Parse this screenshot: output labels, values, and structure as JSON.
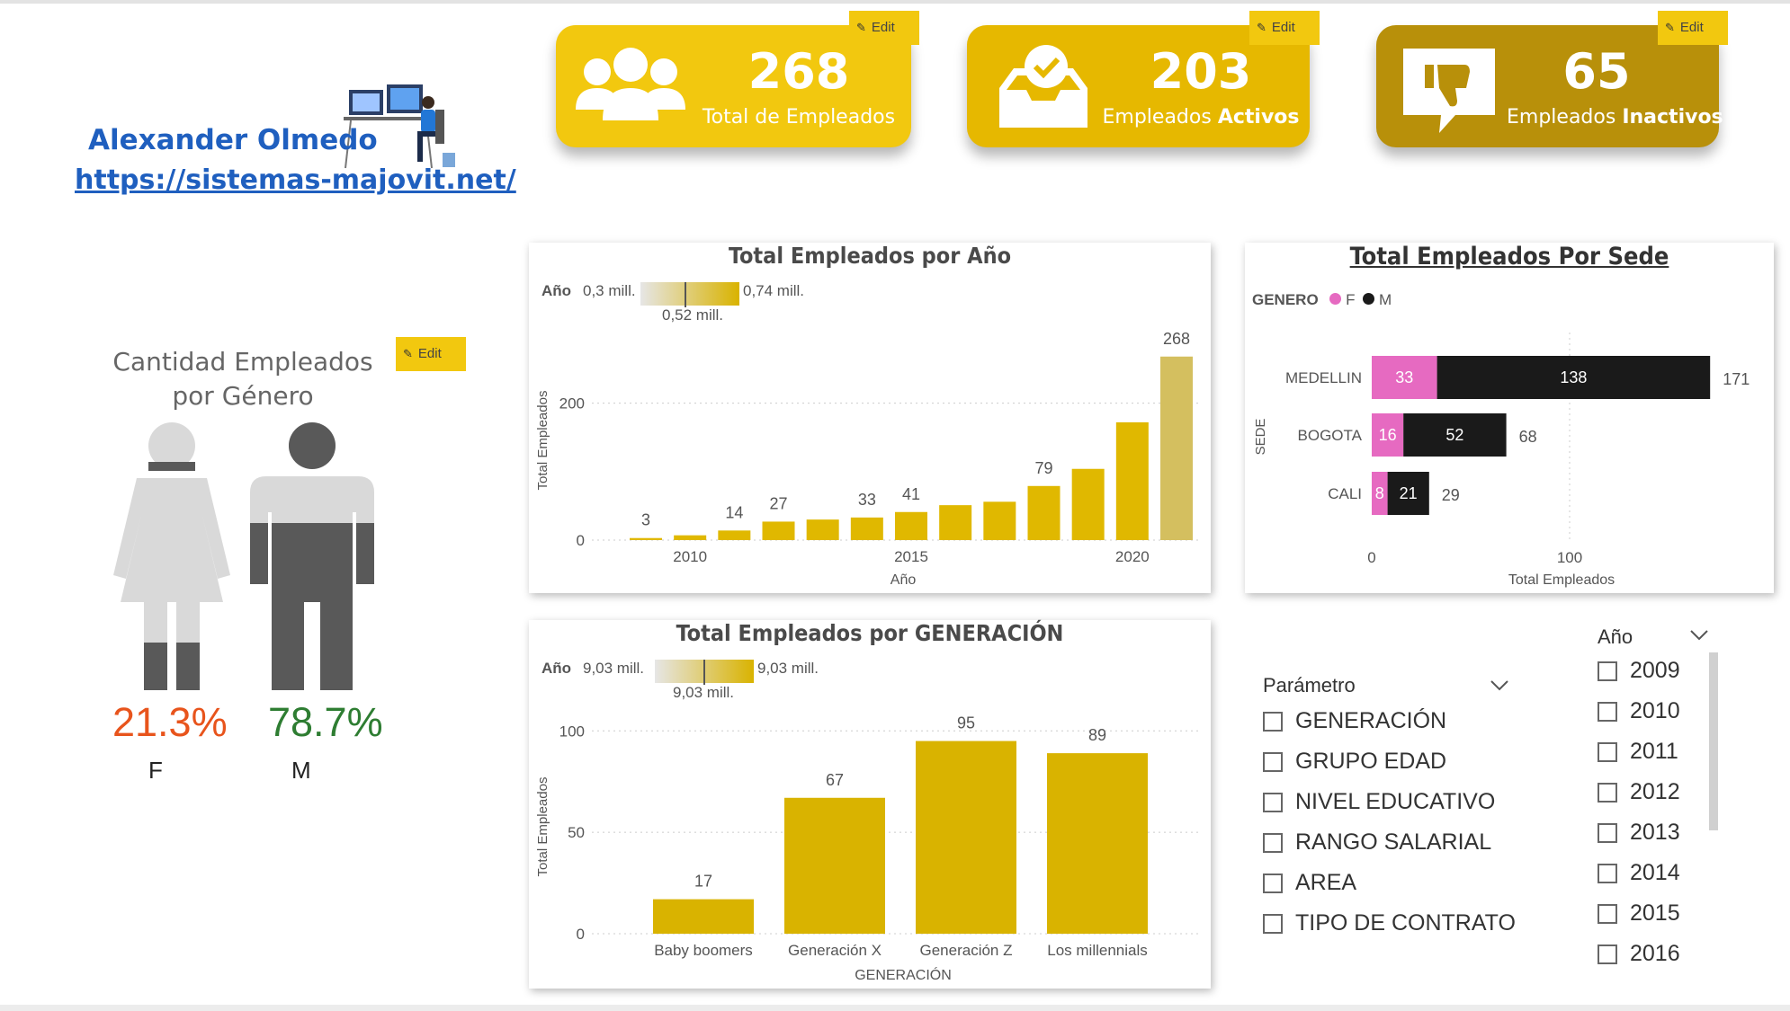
{
  "author": {
    "name": "Alexander Olmedo",
    "url": "https://sistemas-majovit.net/"
  },
  "edit_label": "Edit",
  "kpis": [
    {
      "value": "268",
      "label": "Total de Empleados",
      "icon": "people-icon",
      "color": "#f2c80f"
    },
    {
      "value": "203",
      "label_pre": "Empleados ",
      "label_bold": "Activos",
      "icon": "inbox-check-icon",
      "color": "#e6b800"
    },
    {
      "value": "65",
      "label_pre": "Empleados ",
      "label_bold": "Inactivos",
      "icon": "thumbs-down-icon",
      "color": "#b8900a"
    }
  ],
  "gender": {
    "title": "Cantidad Empleados por Género",
    "female_pct": "21.3%",
    "male_pct": "78.7%",
    "female_label": "F",
    "male_label": "M",
    "colors": {
      "female": "#e8541c",
      "male": "#2e7d32",
      "fill": "#595959",
      "empty": "#d9d9d9"
    }
  },
  "year_chart": {
    "title": "Total Empleados por Año",
    "legend": {
      "label": "Año",
      "min": "0,3 mill.",
      "max": "0,74 mill.",
      "mid": "0,52 mill."
    }
  },
  "gen_chart": {
    "title": "Total Empleados por GENERACIÓN",
    "legend": {
      "label": "Año",
      "min": "9,03 mill.",
      "max": "9,03 mill.",
      "mid": "9,03 mill."
    }
  },
  "sede_chart": {
    "title": "Total Empleados Por Sede",
    "legend_title": "GENERO",
    "legend": [
      {
        "name": "F",
        "color": "#e66ac1"
      },
      {
        "name": "M",
        "color": "#1a1a1a"
      }
    ]
  },
  "parametro": {
    "title": "Parámetro",
    "options": [
      "GENERACIÓN",
      "GRUPO EDAD",
      "NIVEL EDUCATIVO",
      "RANGO SALARIAL",
      "AREA",
      "TIPO DE CONTRATO"
    ]
  },
  "anio_slicer": {
    "title": "Año",
    "options": [
      "2009",
      "2010",
      "2011",
      "2012",
      "2013",
      "2014",
      "2015",
      "2016"
    ]
  },
  "chart_data": [
    {
      "type": "bar",
      "title": "Total Empleados por Año",
      "xlabel": "Año",
      "ylabel": "Total Empleados",
      "x": [
        2009,
        2010,
        2011,
        2012,
        2013,
        2014,
        2015,
        2016,
        2017,
        2018,
        2019,
        2020,
        2021
      ],
      "values": [
        3,
        7,
        14,
        27,
        30,
        33,
        41,
        51,
        56,
        79,
        104,
        172,
        268
      ],
      "data_labels": {
        "2009": "3",
        "2011": "14",
        "2012": "27",
        "2014": "33",
        "2015": "41",
        "2018": "79",
        "2021": "268"
      },
      "x_ticks": [
        "2010",
        "2015",
        "2020"
      ],
      "y_ticks": [
        "0",
        "200"
      ],
      "ylim": [
        0,
        290
      ],
      "color": "#e0b800"
    },
    {
      "type": "bar",
      "title": "Total Empleados por GENERACIÓN",
      "xlabel": "GENERACIÓN",
      "ylabel": "Total Empleados",
      "categories": [
        "Baby boomers",
        "Generación X",
        "Generación Z",
        "Los millennials"
      ],
      "values": [
        17,
        67,
        95,
        89
      ],
      "y_ticks": [
        "0",
        "50",
        "100"
      ],
      "ylim": [
        0,
        105
      ],
      "color": "#d9b300"
    },
    {
      "type": "bar",
      "orientation": "horizontal",
      "stacked": true,
      "title": "Total Empleados Por Sede",
      "xlabel": "Total Empleados",
      "ylabel": "SEDE",
      "categories": [
        "MEDELLIN",
        "BOGOTA",
        "CALI"
      ],
      "series": [
        {
          "name": "F",
          "values": [
            33,
            16,
            8
          ]
        },
        {
          "name": "M",
          "values": [
            138,
            52,
            21
          ]
        }
      ],
      "totals": [
        171,
        68,
        29
      ],
      "x_ticks": [
        "0",
        "100"
      ],
      "xlim": [
        0,
        185
      ]
    }
  ]
}
